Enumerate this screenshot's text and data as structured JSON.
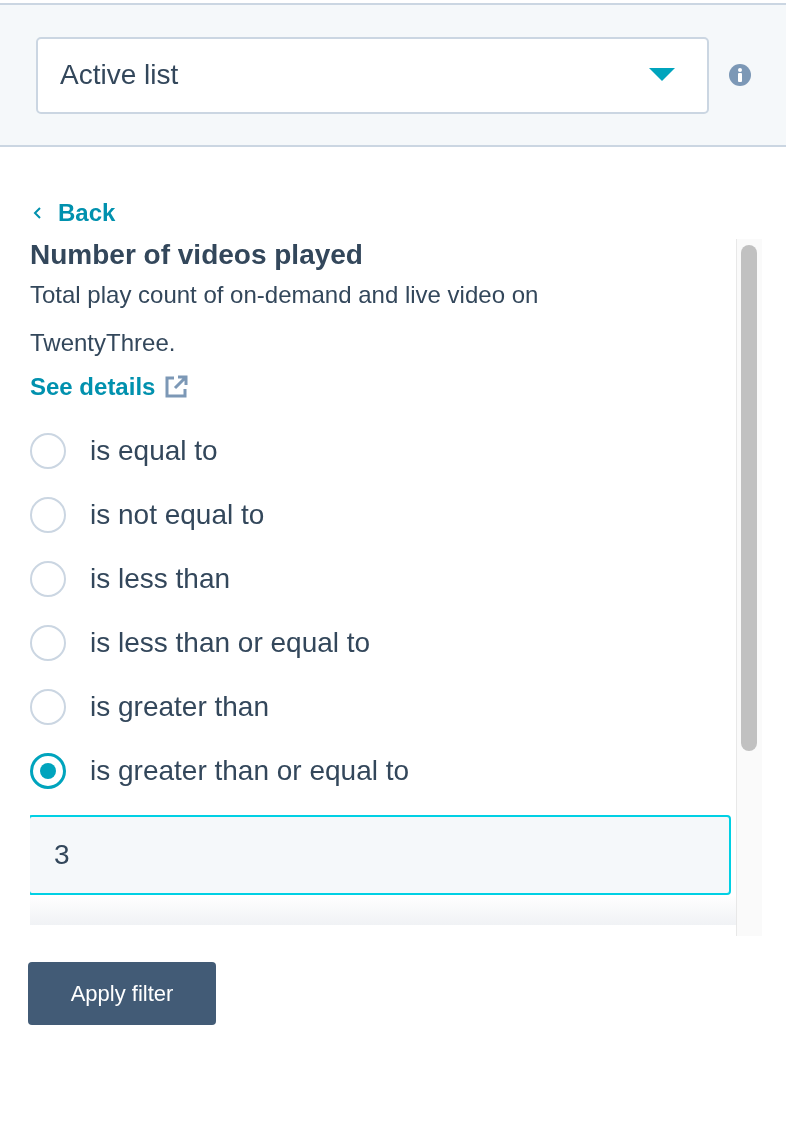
{
  "list_type_select": {
    "value": "Active list"
  },
  "back_link": "Back",
  "property": {
    "title": "Number of videos played",
    "description": "Total play count of on-demand and live video on TwentyThree.",
    "details_link": "See details"
  },
  "operators": [
    {
      "label": "is equal to",
      "selected": false
    },
    {
      "label": "is not equal to",
      "selected": false
    },
    {
      "label": "is less than",
      "selected": false
    },
    {
      "label": "is less than or equal to",
      "selected": false
    },
    {
      "label": "is greater than",
      "selected": false
    },
    {
      "label": "is greater than or equal to",
      "selected": true
    }
  ],
  "value_input": {
    "value": "3"
  },
  "apply_button": "Apply filter"
}
